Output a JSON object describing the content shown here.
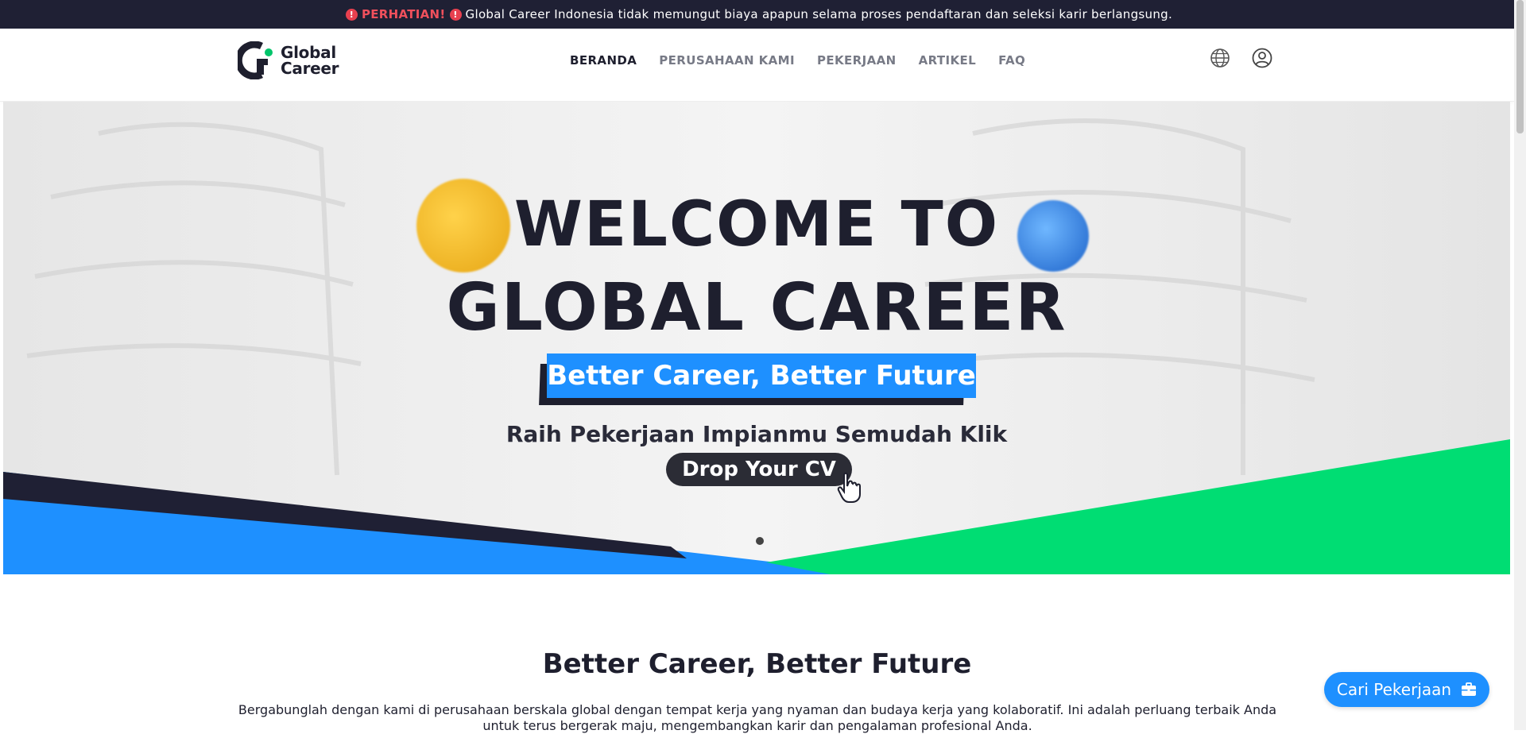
{
  "notice": {
    "warning_label": "PERHATIAN!",
    "message": "Global Career Indonesia tidak memungut biaya apapun selama proses pendaftaran dan seleksi karir berlangsung."
  },
  "header": {
    "logo": {
      "line1": "Global",
      "line2": "Career"
    },
    "nav": [
      {
        "label": "BERANDA",
        "active": true
      },
      {
        "label": "PERUSAHAAN KAMI",
        "active": false
      },
      {
        "label": "PEKERJAAN",
        "active": false
      },
      {
        "label": "ARTIKEL",
        "active": false
      },
      {
        "label": "FAQ",
        "active": false
      }
    ],
    "icons": [
      "globe-icon",
      "user-account-icon"
    ]
  },
  "hero": {
    "title_line1": "WELCOME TO",
    "title_line2": "GLOBAL CAREER",
    "ribbon": "Better Career, Better Future",
    "subtitle": "Raih Pekerjaan Impianmu Semudah Klik",
    "cta": "Drop Your CV",
    "slides": 1,
    "active_slide": 1
  },
  "about": {
    "title": "Better Career, Better Future",
    "text": "Bergabunglah dengan kami di perusahaan berskala global dengan tempat kerja yang nyaman dan budaya kerja yang kolaboratif. Ini adalah perluang terbaik Anda untuk terus bergerak maju, mengembangkan karir dan pengalaman profesional Anda."
  },
  "floating_button": {
    "label": "Cari Pekerjaan",
    "icon": "briefcase-icon"
  },
  "colors": {
    "dark": "#1f2034",
    "blue": "#1e90ff",
    "green": "#00dd73",
    "alert": "#e8404f"
  }
}
